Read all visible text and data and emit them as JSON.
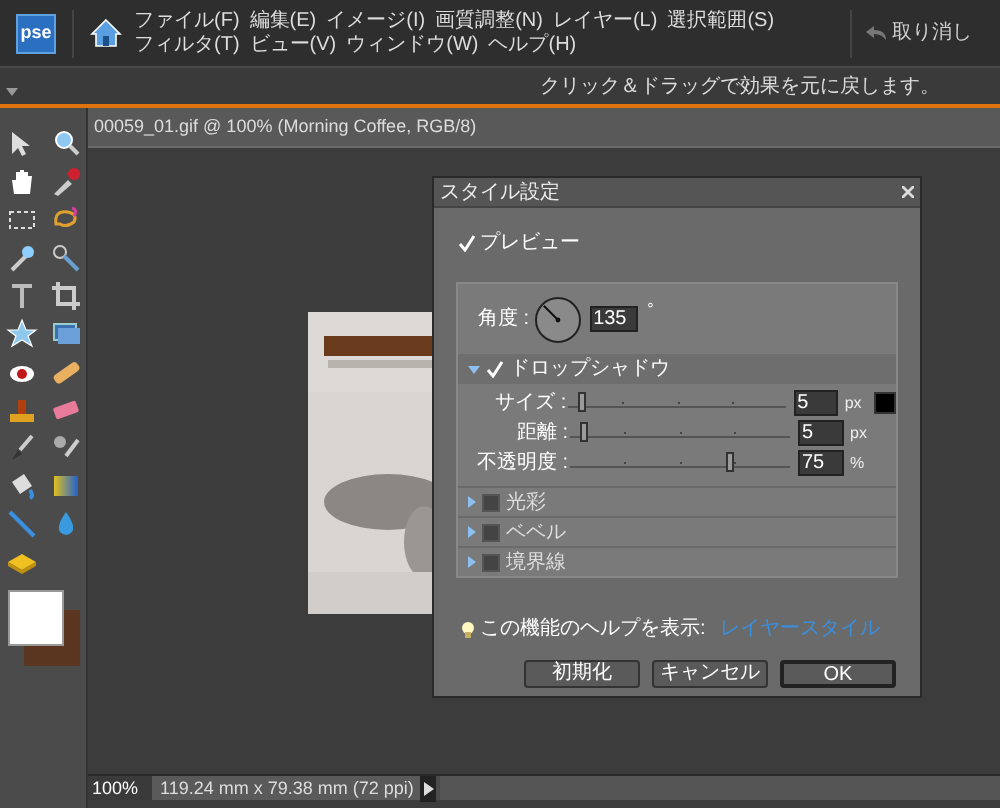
{
  "app": {
    "logo": "pse",
    "menu": [
      "ファイル(F)",
      "編集(E)",
      "イメージ(I)",
      "画質調整(N)",
      "レイヤー(L)",
      "選択範囲(S)",
      "フィルタ(T)",
      "ビュー(V)",
      "ウィンドウ(W)",
      "ヘルプ(H)"
    ],
    "undo": "取り消し"
  },
  "hint": "クリック＆ドラッグで効果を元に戻します。",
  "document": {
    "title": "00059_01.gif @ 100% (Morning Coffee, RGB/8)",
    "zoom": "100%",
    "info": "119.24 mm x 79.38 mm (72 ppi)"
  },
  "toolbox": {
    "swatches": [
      {
        "kind": "foreground",
        "color": "#ffffff"
      },
      {
        "kind": "background",
        "color": "#5a3620"
      }
    ]
  },
  "dialog": {
    "title": "スタイル設定",
    "preview": {
      "label": "プレビュー",
      "checked": true
    },
    "angle": {
      "label": "角度 :",
      "value": "135",
      "unit": "°"
    },
    "sections": [
      {
        "label": "ドロップシャドウ",
        "expanded": true,
        "checked": true,
        "color": "#000000",
        "sliders": [
          {
            "label": "サイズ :",
            "value": "5",
            "unit": "px",
            "level": 0.05
          },
          {
            "label": "距離 :",
            "value": "5",
            "unit": "px",
            "level": 0.05
          },
          {
            "label": "不透明度 :",
            "value": "75",
            "unit": "%",
            "level": 0.75
          }
        ]
      },
      {
        "label": "光彩",
        "expanded": false,
        "checked": false
      },
      {
        "label": "ベベル",
        "expanded": false,
        "checked": false
      },
      {
        "label": "境界線",
        "expanded": false,
        "checked": false
      }
    ],
    "help": {
      "text": "この機能のヘルプを表示:",
      "link": "レイヤースタイル"
    },
    "buttons": [
      {
        "label": "初期化",
        "default": false
      },
      {
        "label": "キャンセル",
        "default": false
      },
      {
        "label": "OK",
        "default": true
      }
    ]
  }
}
